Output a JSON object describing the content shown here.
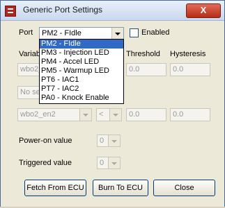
{
  "window": {
    "title": "Generic Port Settings",
    "icon": "app-icon",
    "close_symbol": "X"
  },
  "port": {
    "label": "Port",
    "selected": "PM2 - FIdle",
    "enabled_label": "Enabled",
    "enabled_checked": false,
    "options": [
      "PM2 - FIdle",
      "PM3 - Injection LED",
      "PM4 - Accel LED",
      "PM5 - Warmup LED",
      "PT6 - IAC1",
      "PT7 - IAC2",
      "PA0 - Knock Enable"
    ]
  },
  "conditions": {
    "variable_label_partial": "Variab",
    "threshold_label": "Threshold",
    "hysteresis_label": "Hysteresis",
    "row1": {
      "variable_partial": "wbo2_",
      "threshold": "0.0",
      "hysteresis": "0.0"
    },
    "middle_partial": "No se",
    "row2": {
      "variable": "wbo2_en2",
      "operator": "<",
      "threshold": "0.0",
      "hysteresis": "0.0"
    }
  },
  "power_on": {
    "label": "Power-on value",
    "value": "0"
  },
  "triggered": {
    "label": "Triggered value",
    "value": "0"
  },
  "buttons": {
    "fetch": "Fetch From ECU",
    "burn": "Burn To ECU",
    "close": "Close"
  }
}
